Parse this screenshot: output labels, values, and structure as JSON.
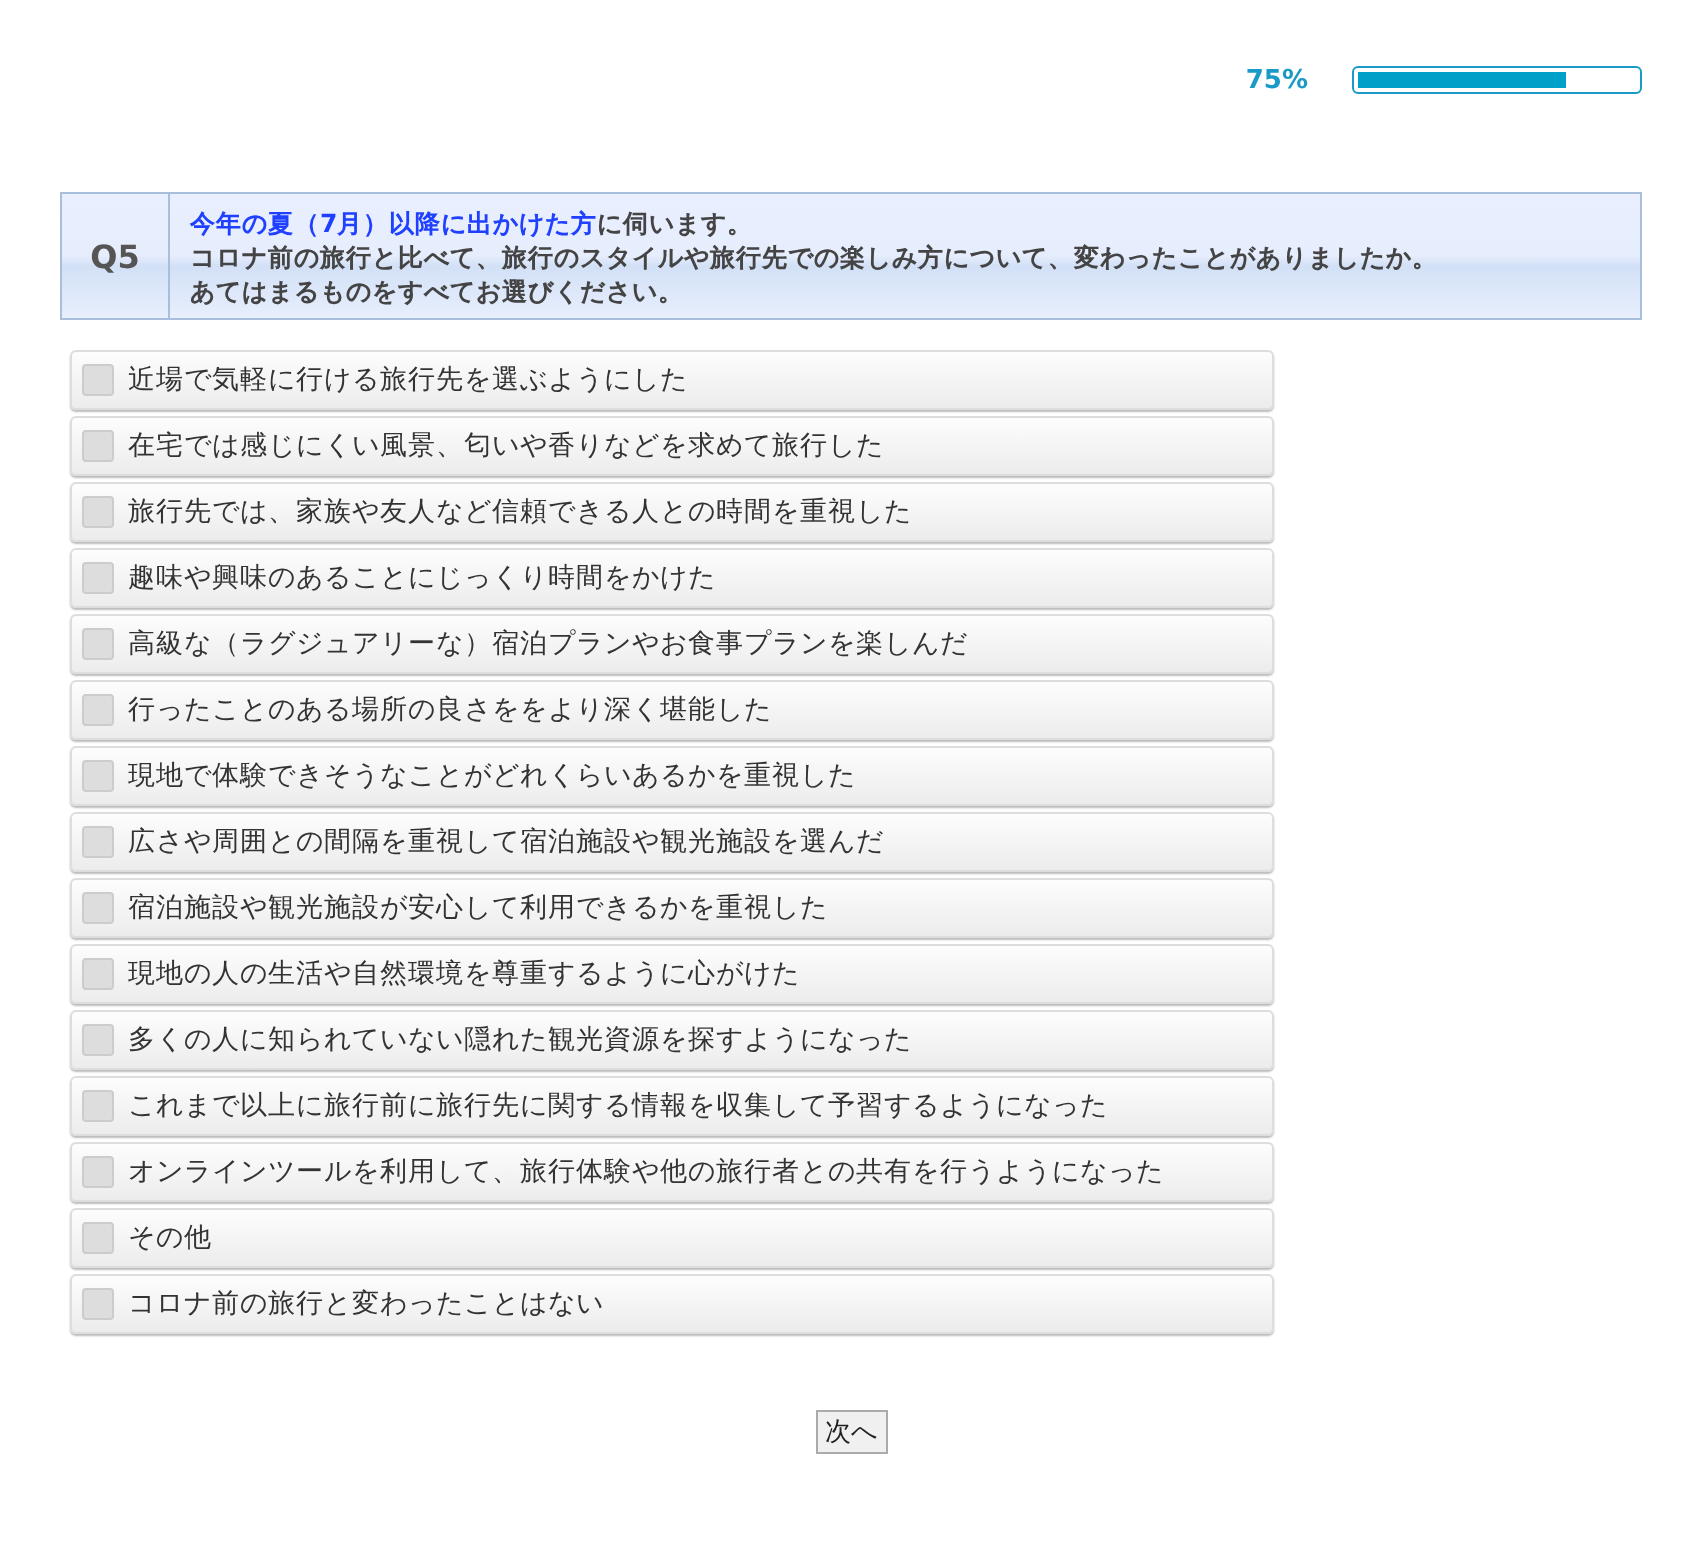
{
  "progress": {
    "label": "75%",
    "level": 0.75
  },
  "question": {
    "number": "Q5",
    "highlight": "今年の夏（7月）以降に出かけた方",
    "lines": [
      "に伺います。",
      "コロナ前の旅行と比べて、旅行のスタイルや旅行先での楽しみ方について、変わったことがありましたか。",
      "あてはまるものをすべてお選びください。"
    ]
  },
  "options": [
    {
      "label": "近場で気軽に行ける旅行先を選ぶようにした",
      "checked": false
    },
    {
      "label": "在宅では感じにくい風景、匂いや香りなどを求めて旅行した",
      "checked": false
    },
    {
      "label": "旅行先では、家族や友人など信頼できる人との時間を重視した",
      "checked": false
    },
    {
      "label": "趣味や興味のあることにじっくり時間をかけた",
      "checked": false
    },
    {
      "label": "高級な（ラグジュアリーな）宿泊プランやお食事プランを楽しんだ",
      "checked": false
    },
    {
      "label": "行ったことのある場所の良さををより深く堪能した",
      "checked": false
    },
    {
      "label": "現地で体験できそうなことがどれくらいあるかを重視した",
      "checked": false
    },
    {
      "label": "広さや周囲との間隔を重視して宿泊施設や観光施設を選んだ",
      "checked": false
    },
    {
      "label": "宿泊施設や観光施設が安心して利用できるかを重視した",
      "checked": false
    },
    {
      "label": "現地の人の生活や自然環境を尊重するように心がけた",
      "checked": false
    },
    {
      "label": "多くの人に知られていない隠れた観光資源を探すようになった",
      "checked": false
    },
    {
      "label": "これまで以上に旅行前に旅行先に関する情報を収集して予習するようになった",
      "checked": false
    },
    {
      "label": "オンラインツールを利用して、旅行体験や他の旅行者との共有を行うようになった",
      "checked": false
    },
    {
      "label": "その他",
      "checked": false
    },
    {
      "label": "コロナ前の旅行と変わったことはない",
      "checked": false
    }
  ],
  "next_button": "次へ"
}
